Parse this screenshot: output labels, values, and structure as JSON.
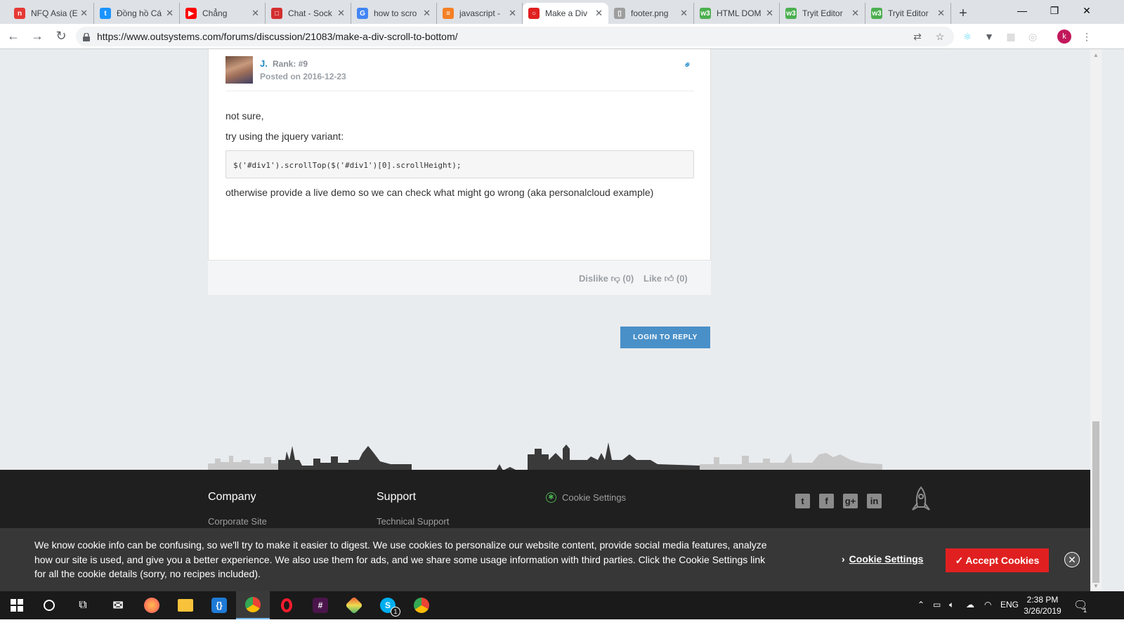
{
  "browser": {
    "tabs": [
      {
        "label": "NFQ Asia (E",
        "icon": "nfq-icon",
        "color": "#e53935",
        "glyph": "n"
      },
      {
        "label": "Đồng hồ Cá",
        "icon": "tiki-icon",
        "color": "#1a94ff",
        "glyph": "t"
      },
      {
        "label": "Chẳng",
        "icon": "youtube-icon",
        "color": "#ff0000",
        "glyph": "▶"
      },
      {
        "label": "Chat - Sock",
        "icon": "chat-icon",
        "color": "#d32f2f",
        "glyph": "□"
      },
      {
        "label": "how to scro",
        "icon": "google-icon",
        "color": "#4285f4",
        "glyph": "G"
      },
      {
        "label": "javascript -",
        "icon": "stackoverflow-icon",
        "color": "#f48024",
        "glyph": "≡"
      },
      {
        "label": "Make a Div",
        "icon": "outsystems-icon",
        "color": "#e02020",
        "glyph": "○"
      },
      {
        "label": "footer.png",
        "icon": "file-icon",
        "color": "#9e9e9e",
        "glyph": "▯"
      },
      {
        "label": "HTML DOM",
        "icon": "w3schools-icon",
        "color": "#4caf50",
        "glyph": "w3"
      },
      {
        "label": "Tryit Editor",
        "icon": "w3schools-icon",
        "color": "#4caf50",
        "glyph": "w3"
      },
      {
        "label": "Tryit Editor",
        "icon": "w3schools-icon",
        "color": "#4caf50",
        "glyph": "w3"
      }
    ],
    "active_tab": 6,
    "url": "https://www.outsystems.com/forums/discussion/21083/make-a-div-scroll-to-bottom/",
    "profile_initial": "k"
  },
  "post": {
    "author": "J.",
    "rank": "Rank: #9",
    "posted": "Posted on 2016-12-23",
    "para1": "not sure,",
    "para2": "try using the jquery variant:",
    "code": "$('#div1').scrollTop($('#div1')[0].scrollHeight);",
    "para3": "otherwise provide a live demo so we can check what might go wrong (aka personalcloud example)",
    "dislike": "Dislike",
    "dislike_count": "(0)",
    "like": "Like",
    "like_count": "(0)"
  },
  "login_reply": "LOGIN TO REPLY",
  "footer": {
    "company_heading": "Company",
    "company_link": "Corporate Site",
    "support_heading": "Support",
    "support_link": "Technical Support",
    "cookie_settings": "Cookie Settings",
    "social": [
      "twitter-icon",
      "facebook-icon",
      "google-plus-icon",
      "linkedin-icon"
    ]
  },
  "cookie_banner": {
    "text": "We know cookie info can be confusing, so we'll try to make it easier to digest. We use cookies to personalize our website content, provide social media features, analyze how our site is used, and give you a better experience. We also use them for ads, and we share some usage information with third parties. Click the Cookie Settings link for all the cookie details (sorry, no recipes included).",
    "settings_label": "Cookie Settings",
    "accept_label": "Accept Cookies"
  },
  "taskbar": {
    "apps": [
      "start-icon",
      "cortana-icon",
      "task-view-icon",
      "mail-icon",
      "firefox-icon",
      "file-explorer-icon",
      "vscode-icon",
      "chrome-icon",
      "opera-icon",
      "slack-icon",
      "git-icon",
      "skype-icon",
      "chrome-icon"
    ],
    "skype_badge": "1",
    "language": "ENG",
    "time": "2:38 PM",
    "date": "3/26/2019",
    "notification_badge": "1"
  }
}
